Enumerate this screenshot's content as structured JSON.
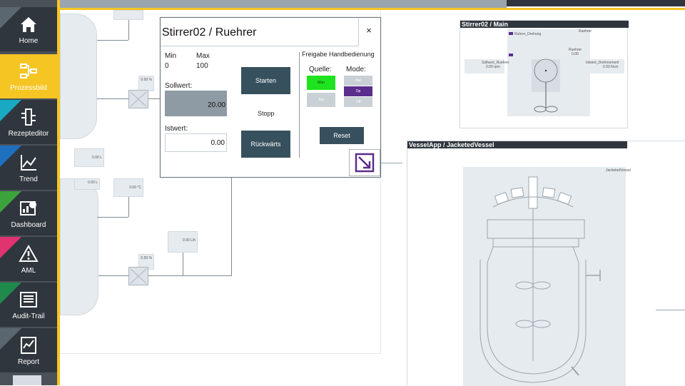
{
  "nav": {
    "items": [
      {
        "label": "Home",
        "color": "#5b6770",
        "icon": "home-icon"
      },
      {
        "label": "Prozessbild",
        "color": "#f5c523",
        "icon": "process-diagram-icon",
        "active": true
      },
      {
        "label": "Rezepteditor",
        "color": "#1aa9c2",
        "icon": "recipe-editor-icon"
      },
      {
        "label": "Trend",
        "color": "#1f6fbf",
        "icon": "trend-chart-icon"
      },
      {
        "label": "Dashboard",
        "color": "#3ca23c",
        "icon": "dashboard-icon"
      },
      {
        "label": "AML",
        "color": "#e0336f",
        "icon": "warning-icon"
      },
      {
        "label": "Audit-Trail",
        "color": "#1f8a4c",
        "icon": "audit-trail-icon"
      },
      {
        "label": "Report",
        "color": "#5b6770",
        "icon": "report-icon"
      }
    ]
  },
  "canvas": {
    "mini_values": {
      "v1": "0.00 %",
      "v2": "0.00 L",
      "v3": "0.00 L",
      "v4": "0.00 °C",
      "v5": "0.00 L/h",
      "v6": "0.00 %"
    }
  },
  "dialog": {
    "title": "Stirrer02 / Ruehrer",
    "close_label": "×",
    "min_label": "Min",
    "max_label": "Max",
    "min_value": "0",
    "max_value": "100",
    "sollwert_label": "Sollwert:",
    "sollwert_value": "20.00",
    "istwert_label": "Istwert:",
    "istwert_value": "0.00",
    "start_label": "Starten",
    "stop_label": "Stopp",
    "reverse_label": "Rückwärts",
    "freigabe_label": "Freigabe Handbedienung",
    "quelle_label": "Quelle:",
    "mode_label": "Mode:",
    "quelle_options": [
      "Man",
      "Aut"
    ],
    "mode_options": [
      "Aut",
      "Op",
      "Off"
    ],
    "reset_label": "Reset"
  },
  "panels": {
    "main": {
      "title": "Stirrer02 / Main",
      "tag_ruehrer": "Ruehrer",
      "tag_rotation": "Ruhrer_Drehung",
      "tag_sollwert": "Sollwert_Ruehrer",
      "sollwert_value": "0.00 rpm",
      "tag_drehmoment": "Istwert_Drehmoment",
      "drehmoment_value": "0.00 Ncm",
      "value_center": "0.00"
    },
    "vessel": {
      "title": "VesselApp / JacketedVessel",
      "tag": "JacketedVessel"
    }
  },
  "colors": {
    "accent_yellow": "#f5c523",
    "button_dark": "#37505d",
    "manual_green": "#1fe31f",
    "op_purple": "#5b2d8e"
  }
}
